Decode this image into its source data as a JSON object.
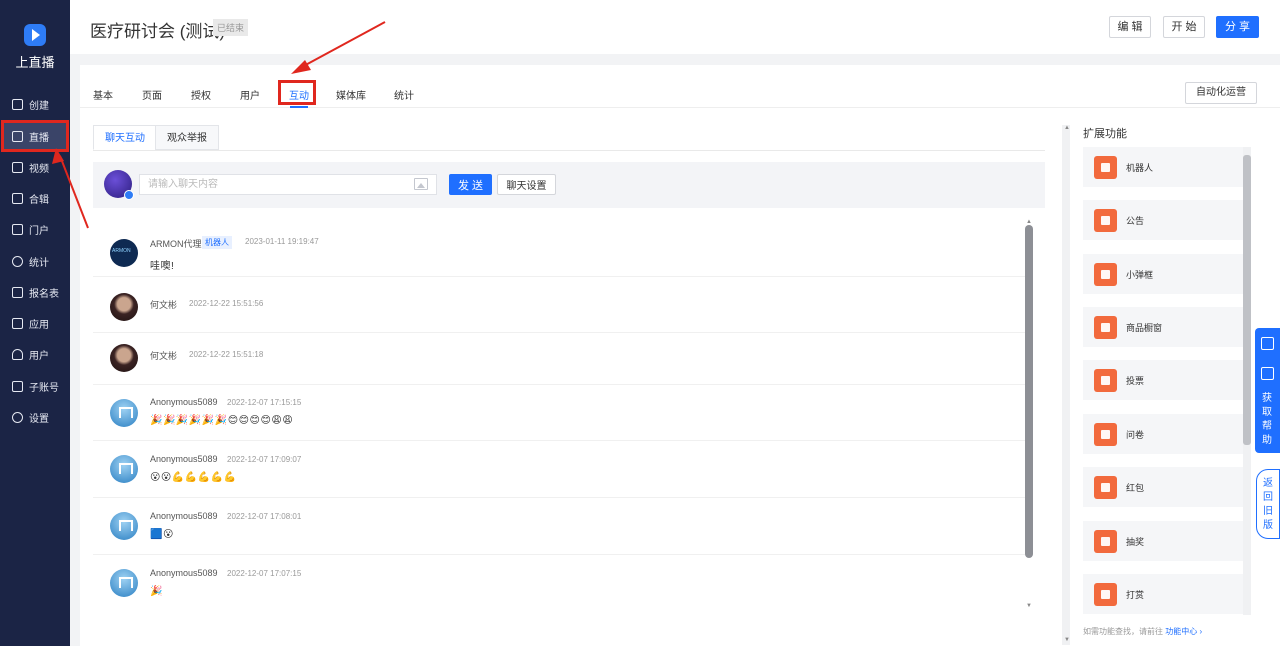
{
  "app": {
    "logo_text": "上直播"
  },
  "sidebar": {
    "items": [
      {
        "label": "创建",
        "icon": "plus-square-icon"
      },
      {
        "label": "直播",
        "icon": "video-camera-icon",
        "active": true
      },
      {
        "label": "视频",
        "icon": "film-icon"
      },
      {
        "label": "合辑",
        "icon": "folder-icon"
      },
      {
        "label": "门户",
        "icon": "monitor-icon"
      },
      {
        "label": "统计",
        "icon": "pie-chart-icon"
      },
      {
        "label": "报名表",
        "icon": "form-icon"
      },
      {
        "label": "应用",
        "icon": "grid-icon"
      },
      {
        "label": "用户",
        "icon": "users-icon"
      },
      {
        "label": "子账号",
        "icon": "sub-account-icon"
      },
      {
        "label": "设置",
        "icon": "gear-icon"
      }
    ]
  },
  "header": {
    "title": "医疗研讨会 (测试)",
    "status_badge": "已结束",
    "edit_label": "编 辑",
    "start_label": "开 始",
    "share_label": "分 享"
  },
  "tabs": [
    {
      "label": "基本"
    },
    {
      "label": "页面"
    },
    {
      "label": "授权"
    },
    {
      "label": "用户"
    },
    {
      "label": "互动",
      "active": true
    },
    {
      "label": "媒体库"
    },
    {
      "label": "统计"
    }
  ],
  "automation_label": "自动化运营",
  "subtabs": [
    {
      "label": "聊天互动",
      "active": true
    },
    {
      "label": "观众举报"
    }
  ],
  "chat_input": {
    "placeholder": "请输入聊天内容",
    "send_label": "发 送",
    "settings_label": "聊天设置"
  },
  "messages": [
    {
      "name": "ARMON代理",
      "tag": "机器人",
      "time": "2023-01-11 19:19:47",
      "text": "哇噢!",
      "avatar": "armon",
      "avatar_text": "ARMON"
    },
    {
      "name": "何文彬",
      "time": "2022-12-22 15:51:56",
      "text": "",
      "avatar": "photo"
    },
    {
      "name": "何文彬",
      "time": "2022-12-22 15:51:18",
      "text": "",
      "avatar": "photo"
    },
    {
      "name": "Anonymous5089",
      "time": "2022-12-07 17:15:15",
      "text": "🎉🎉🎉🎉🎉🎉😊😊😊😊😩😩",
      "avatar": "anon"
    },
    {
      "name": "Anonymous5089",
      "time": "2022-12-07 17:09:07",
      "text": "😮😮💪💪💪💪💪",
      "avatar": "anon"
    },
    {
      "name": "Anonymous5089",
      "time": "2022-12-07 17:08:01",
      "text": "🟦😮",
      "avatar": "anon"
    },
    {
      "name": "Anonymous5089",
      "time": "2022-12-07 17:07:15",
      "text": "🎉",
      "avatar": "anon"
    }
  ],
  "extensions": {
    "title": "扩展功能",
    "items": [
      {
        "label": "机器人",
        "icon": "robot-icon"
      },
      {
        "label": "公告",
        "icon": "megaphone-icon"
      },
      {
        "label": "小弹框",
        "icon": "popup-icon"
      },
      {
        "label": "商品橱窗",
        "icon": "cart-icon"
      },
      {
        "label": "投票",
        "icon": "vote-icon"
      },
      {
        "label": "问卷",
        "icon": "questionnaire-icon"
      },
      {
        "label": "红包",
        "icon": "red-packet-icon"
      },
      {
        "label": "抽奖",
        "icon": "lottery-icon"
      },
      {
        "label": "打赏",
        "icon": "reward-icon"
      }
    ],
    "footer_text": "如需功能查找，请前往",
    "footer_link": "功能中心 ›"
  },
  "float": {
    "help_label": "获取帮助",
    "old_version_label": "返回旧版"
  },
  "colors": {
    "primary": "#1f6fff",
    "sidebar": "#1b2445",
    "accent_orange": "#f26a3d",
    "annotation_red": "#e0271e"
  }
}
